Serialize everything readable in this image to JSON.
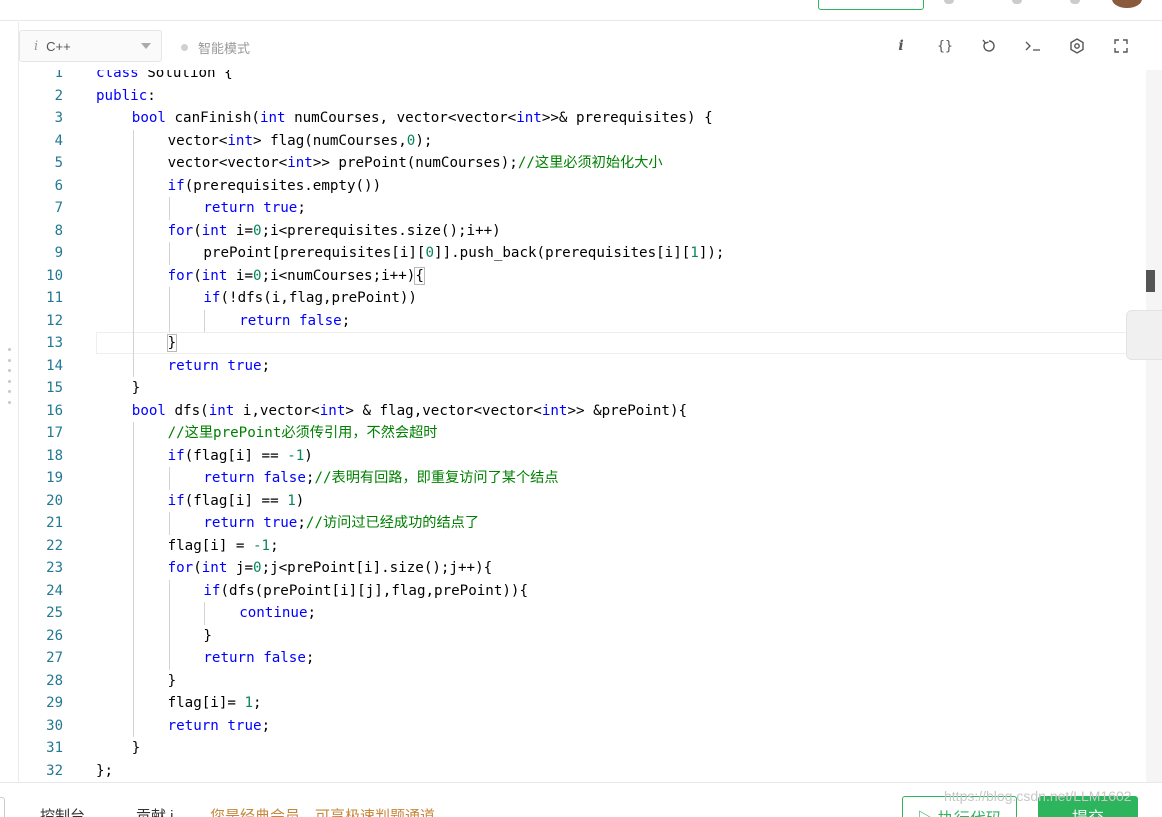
{
  "toolbar": {
    "language": "C++",
    "mode": "智能模式",
    "icons": [
      "info-icon",
      "braces-icon",
      "reset-icon",
      "terminal-icon",
      "settings-icon",
      "fullscreen-icon"
    ]
  },
  "code": [
    {
      "n": "1",
      "indent": 0,
      "segs": [
        [
          "kw",
          "class"
        ],
        [
          "t",
          " Solution {"
        ]
      ]
    },
    {
      "n": "2",
      "indent": 0,
      "segs": [
        [
          "kw",
          "public"
        ],
        [
          "t",
          ":"
        ]
      ]
    },
    {
      "n": "3",
      "indent": 1,
      "segs": [
        [
          "kw",
          "bool"
        ],
        [
          "t",
          " canFinish("
        ],
        [
          "kw",
          "int"
        ],
        [
          "t",
          " numCourses, vector<vector<"
        ],
        [
          "kw",
          "int"
        ],
        [
          "t",
          ">>& prerequisites) {"
        ]
      ]
    },
    {
      "n": "4",
      "indent": 2,
      "segs": [
        [
          "t",
          "vector<"
        ],
        [
          "kw",
          "int"
        ],
        [
          "t",
          "> flag(numCourses,"
        ],
        [
          "num",
          "0"
        ],
        [
          "t",
          ");"
        ]
      ]
    },
    {
      "n": "5",
      "indent": 2,
      "segs": [
        [
          "t",
          "vector<vector<"
        ],
        [
          "kw",
          "int"
        ],
        [
          "t",
          ">> prePoint(numCourses);"
        ],
        [
          "cm",
          "//这里必须初始化大小"
        ]
      ]
    },
    {
      "n": "6",
      "indent": 2,
      "segs": [
        [
          "kw",
          "if"
        ],
        [
          "t",
          "(prerequisites.empty())"
        ]
      ]
    },
    {
      "n": "7",
      "indent": 3,
      "segs": [
        [
          "kw",
          "return"
        ],
        [
          "t",
          " "
        ],
        [
          "kw",
          "true"
        ],
        [
          "t",
          ";"
        ]
      ]
    },
    {
      "n": "8",
      "indent": 2,
      "segs": [
        [
          "kw",
          "for"
        ],
        [
          "t",
          "("
        ],
        [
          "kw",
          "int"
        ],
        [
          "t",
          " i="
        ],
        [
          "num",
          "0"
        ],
        [
          "t",
          ";i<prerequisites.size();i++)"
        ]
      ]
    },
    {
      "n": "9",
      "indent": 3,
      "segs": [
        [
          "t",
          "prePoint[prerequisites[i]["
        ],
        [
          "num",
          "0"
        ],
        [
          "t",
          "]].push_back(prerequisites[i]["
        ],
        [
          "num",
          "1"
        ],
        [
          "t",
          "]);"
        ]
      ]
    },
    {
      "n": "10",
      "indent": 2,
      "segs": [
        [
          "kw",
          "for"
        ],
        [
          "t",
          "("
        ],
        [
          "kw",
          "int"
        ],
        [
          "t",
          " i="
        ],
        [
          "num",
          "0"
        ],
        [
          "t",
          ";i<numCourses;i++)"
        ],
        [
          "brk",
          "{"
        ]
      ]
    },
    {
      "n": "11",
      "indent": 3,
      "segs": [
        [
          "kw",
          "if"
        ],
        [
          "t",
          "(!dfs(i,flag,prePoint))"
        ]
      ]
    },
    {
      "n": "12",
      "indent": 4,
      "segs": [
        [
          "kw",
          "return"
        ],
        [
          "t",
          " "
        ],
        [
          "kw",
          "false"
        ],
        [
          "t",
          ";"
        ]
      ]
    },
    {
      "n": "13",
      "indent": 2,
      "segs": [
        [
          "brk",
          "}"
        ]
      ]
    },
    {
      "n": "14",
      "indent": 2,
      "segs": [
        [
          "kw",
          "return"
        ],
        [
          "t",
          " "
        ],
        [
          "kw",
          "true"
        ],
        [
          "t",
          ";"
        ]
      ]
    },
    {
      "n": "15",
      "indent": 1,
      "segs": [
        [
          "t",
          "}"
        ]
      ]
    },
    {
      "n": "16",
      "indent": 1,
      "segs": [
        [
          "kw",
          "bool"
        ],
        [
          "t",
          " dfs("
        ],
        [
          "kw",
          "int"
        ],
        [
          "t",
          " i,vector<"
        ],
        [
          "kw",
          "int"
        ],
        [
          "t",
          "> & flag,vector<vector<"
        ],
        [
          "kw",
          "int"
        ],
        [
          "t",
          ">> &prePoint){"
        ]
      ]
    },
    {
      "n": "17",
      "indent": 2,
      "segs": [
        [
          "cm",
          "//这里prePoint必须传引用，不然会超时"
        ]
      ]
    },
    {
      "n": "18",
      "indent": 2,
      "segs": [
        [
          "kw",
          "if"
        ],
        [
          "t",
          "(flag[i] == "
        ],
        [
          "num",
          "-1"
        ],
        [
          "t",
          ")"
        ]
      ]
    },
    {
      "n": "19",
      "indent": 3,
      "segs": [
        [
          "kw",
          "return"
        ],
        [
          "t",
          " "
        ],
        [
          "kw",
          "false"
        ],
        [
          "t",
          ";"
        ],
        [
          "cm",
          "//表明有回路，即重复访问了某个结点"
        ]
      ]
    },
    {
      "n": "20",
      "indent": 2,
      "segs": [
        [
          "kw",
          "if"
        ],
        [
          "t",
          "(flag[i] == "
        ],
        [
          "num",
          "1"
        ],
        [
          "t",
          ")"
        ]
      ]
    },
    {
      "n": "21",
      "indent": 3,
      "segs": [
        [
          "kw",
          "return"
        ],
        [
          "t",
          " "
        ],
        [
          "kw",
          "true"
        ],
        [
          "t",
          ";"
        ],
        [
          "cm",
          "//访问过已经成功的结点了"
        ]
      ]
    },
    {
      "n": "22",
      "indent": 2,
      "segs": [
        [
          "t",
          "flag[i] = "
        ],
        [
          "num",
          "-1"
        ],
        [
          "t",
          ";"
        ]
      ]
    },
    {
      "n": "23",
      "indent": 2,
      "segs": [
        [
          "kw",
          "for"
        ],
        [
          "t",
          "("
        ],
        [
          "kw",
          "int"
        ],
        [
          "t",
          " j="
        ],
        [
          "num",
          "0"
        ],
        [
          "t",
          ";j<prePoint[i].size();j++){"
        ]
      ]
    },
    {
      "n": "24",
      "indent": 3,
      "segs": [
        [
          "kw",
          "if"
        ],
        [
          "t",
          "(dfs(prePoint[i][j],flag,prePoint)){"
        ]
      ]
    },
    {
      "n": "25",
      "indent": 4,
      "segs": [
        [
          "kw",
          "continue"
        ],
        [
          "t",
          ";"
        ]
      ]
    },
    {
      "n": "26",
      "indent": 3,
      "segs": [
        [
          "t",
          "}"
        ]
      ]
    },
    {
      "n": "27",
      "indent": 3,
      "segs": [
        [
          "kw",
          "return"
        ],
        [
          "t",
          " "
        ],
        [
          "kw",
          "false"
        ],
        [
          "t",
          ";"
        ]
      ]
    },
    {
      "n": "28",
      "indent": 2,
      "segs": [
        [
          "t",
          "}"
        ]
      ]
    },
    {
      "n": "29",
      "indent": 2,
      "segs": [
        [
          "t",
          "flag[i]= "
        ],
        [
          "num",
          "1"
        ],
        [
          "t",
          ";"
        ]
      ]
    },
    {
      "n": "30",
      "indent": 2,
      "segs": [
        [
          "kw",
          "return"
        ],
        [
          "t",
          " "
        ],
        [
          "kw",
          "true"
        ],
        [
          "t",
          ";"
        ]
      ]
    },
    {
      "n": "31",
      "indent": 1,
      "segs": [
        [
          "t",
          "}"
        ]
      ]
    },
    {
      "n": "32",
      "indent": 0,
      "segs": [
        [
          "t",
          "};"
        ]
      ]
    }
  ],
  "bottom": {
    "console": "控制台",
    "contribute": "贡献 i",
    "member_notice": "您是经典会员，可享极速判题通道",
    "run": "▷ 执行代码",
    "submit": "提交"
  },
  "watermark": "https://blog.csdn.net/LLM1602"
}
